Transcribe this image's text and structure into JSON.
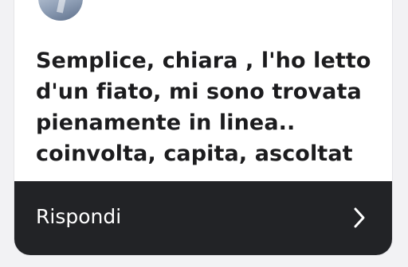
{
  "message": {
    "text": "Semplice, chiara , l'ho letto\nd'un fiato, mi sono trovata\npienamente in linea..\ncoinvolta, capita, ascoltat"
  },
  "reply": {
    "label": "Rispondi",
    "icon": "chevron-right-icon"
  },
  "colors": {
    "card_background": "#ffffff",
    "reply_bar_background": "#222326",
    "text": "#1c1c1e"
  }
}
